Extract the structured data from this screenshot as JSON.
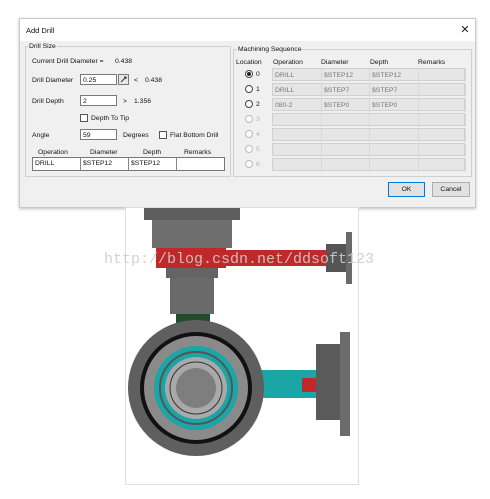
{
  "dialog": {
    "title": "Add Drill",
    "close_symbol": "✕",
    "drill_size": {
      "legend": "Drill Size",
      "current_label": "Current Drill Diameter =",
      "current_value": "0.438",
      "diameter_label": "Drill Diameter",
      "diameter_value": "0.25",
      "diameter_cmp": "<",
      "diameter_ref": "0.438",
      "depth_label": "Drill Depth",
      "depth_value": "2",
      "depth_cmp": ">",
      "depth_ref": "1.356",
      "depth_to_tip_label": "Depth To Tip",
      "angle_label": "Angle",
      "angle_value": "59",
      "degrees_label": "Degrees",
      "flat_bottom_label": "Flat Bottom Drill",
      "table_headers": [
        "Operation",
        "Diameter",
        "Depth",
        "Remarks"
      ],
      "table_row": [
        "DRILL",
        "$STEP12",
        "$STEP12",
        ""
      ]
    },
    "sequence": {
      "legend": "Machining Sequence",
      "headers": [
        "Location",
        "Operation",
        "Diameter",
        "Depth",
        "Remarks"
      ],
      "rows": [
        {
          "location": "0",
          "operation": "DRILL",
          "diameter": "$STEP12",
          "depth": "$STEP12",
          "remarks": "",
          "selected": true,
          "enabled": true
        },
        {
          "location": "1",
          "operation": "DRILL",
          "diameter": "$STEP7",
          "depth": "$STEP7",
          "remarks": "",
          "selected": false,
          "enabled": true
        },
        {
          "location": "2",
          "operation": "080-2",
          "diameter": "$STEP0",
          "depth": "$STEP0",
          "remarks": "",
          "selected": false,
          "enabled": true
        },
        {
          "location": "3",
          "operation": "",
          "diameter": "",
          "depth": "",
          "remarks": "",
          "selected": false,
          "enabled": false
        },
        {
          "location": "4",
          "operation": "",
          "diameter": "",
          "depth": "",
          "remarks": "",
          "selected": false,
          "enabled": false
        },
        {
          "location": "5",
          "operation": "",
          "diameter": "",
          "depth": "",
          "remarks": "",
          "selected": false,
          "enabled": false
        },
        {
          "location": "6",
          "operation": "",
          "diameter": "",
          "depth": "",
          "remarks": "",
          "selected": false,
          "enabled": false
        }
      ]
    },
    "buttons": {
      "ok": "OK",
      "cancel": "Cancel"
    }
  },
  "watermark": "http://blog.csdn.net/ddsoft123",
  "colors": {
    "red_channel": "#c0282a",
    "teal": "#1aa6a6",
    "gray_body": "#6e6e6e",
    "dark_green": "#1e4d2b"
  }
}
